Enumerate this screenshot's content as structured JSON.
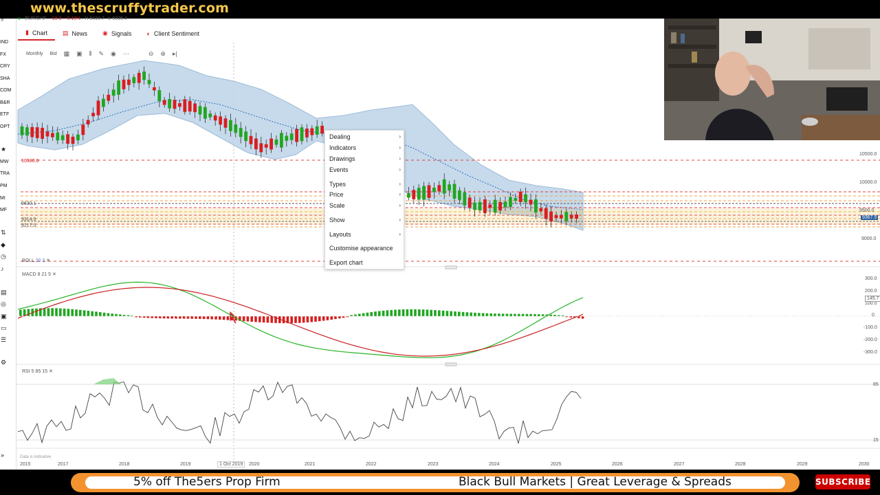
{
  "banner": {
    "site": "www.thescruffytrader.com"
  },
  "header": {
    "pair": "EUR/CHF",
    "change": "-18.3",
    "pct": "-0.19%",
    "high": "H 9410.7",
    "low": "L 9306.4"
  },
  "tabs": [
    {
      "label": "Chart",
      "active": true,
      "icon": "chart-icon"
    },
    {
      "label": "News",
      "active": false,
      "icon": "news-icon"
    },
    {
      "label": "Signals",
      "active": false,
      "icon": "signals-icon"
    },
    {
      "label": "Client Sentiment",
      "active": false,
      "icon": "sentiment-icon"
    }
  ],
  "toolbar": {
    "interval": "Monthly",
    "price_type": "Bid"
  },
  "sidebar": {
    "items": [
      "IND",
      "FX",
      "CRY",
      "SHA",
      "COM",
      "B&R",
      "ETF",
      "OPT",
      "MW",
      "TRA",
      "PM",
      "MI",
      "MF"
    ]
  },
  "context_menu": {
    "items": [
      {
        "label": "Dealing",
        "submenu": true
      },
      {
        "label": "Indicators",
        "submenu": true
      },
      {
        "label": "Drawings",
        "submenu": true
      },
      {
        "label": "Events",
        "submenu": true
      },
      {
        "label": "Types",
        "submenu": true
      },
      {
        "label": "Price",
        "submenu": true
      },
      {
        "label": "Scale",
        "submenu": true
      },
      {
        "label": "Show",
        "submenu": true
      },
      {
        "label": "Layouts",
        "submenu": true
      },
      {
        "label": "Customise appearance",
        "submenu": false
      },
      {
        "label": "Export chart",
        "submenu": false
      }
    ]
  },
  "indicators": {
    "boll": {
      "name": "BOLL",
      "params": "20  2"
    },
    "macd": {
      "name": "MACD",
      "params": "8  21  5"
    },
    "rsi": {
      "name": "RSI",
      "params": "5  85  15"
    }
  },
  "price_axis": [
    "10500.0",
    "10000.0",
    "9500.0",
    "9000.0"
  ],
  "current_price": "9367.5",
  "left_price_tags": [
    "10380.8",
    "9630.1",
    "9314.9",
    "9217.0"
  ],
  "macd_axis": [
    "300.0",
    "200.0",
    "100.0",
    "0",
    "-100.0",
    "-200.0",
    "-300.0"
  ],
  "macd_current": "145.7",
  "rsi_axis": [
    "85",
    "15"
  ],
  "years": [
    "2015",
    "2017",
    "2018",
    "2019",
    "2020",
    "2021",
    "2022",
    "2023",
    "2024",
    "2025",
    "2026",
    "2027",
    "2028",
    "2029",
    "2030"
  ],
  "crosshair_date": "1 Oct 2019",
  "footnote": "Data is indicative",
  "ticker": {
    "left": "5% off The5ers Prop Firm",
    "right": "Black Bull Markets | Great Leverage & Spreads"
  },
  "subscribe_label": "SUBSCRIBE",
  "colors": {
    "up": "#21a621",
    "down": "#d81e1e",
    "band": "#bcd3e8",
    "accent": "#d3262b",
    "ticker": "#f3932f"
  }
}
